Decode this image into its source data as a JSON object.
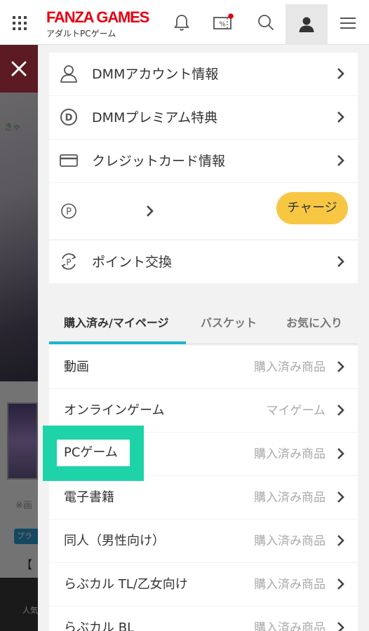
{
  "header": {
    "logo": "FANZA GAMES",
    "logo_sub": "アダルトPCゲーム"
  },
  "background": {
    "banner_text": "きゃ",
    "note": "※画",
    "pill": "プラ",
    "bracket": "【",
    "footer_label": "人気"
  },
  "account_menu": [
    {
      "label": "DMMアカウント情報",
      "icon": "user-icon"
    },
    {
      "label": "DMMプレミアム特典",
      "icon": "premium-d-icon"
    },
    {
      "label": "クレジットカード情報",
      "icon": "credit-card-icon"
    },
    {
      "label": "",
      "icon": "point-icon",
      "action": "チャージ"
    },
    {
      "label": "ポイント交換",
      "icon": "point-exchange-icon"
    }
  ],
  "tabs": [
    {
      "label": "購入済み/マイページ",
      "active": true
    },
    {
      "label": "バスケット",
      "active": false
    },
    {
      "label": "お気に入り",
      "active": false
    }
  ],
  "list": [
    {
      "label": "動画",
      "sub": "購入済み商品"
    },
    {
      "label": "オンラインゲーム",
      "sub": "マイゲーム"
    },
    {
      "label": "PCゲーム",
      "sub": "購入済み商品"
    },
    {
      "label": "電子書籍",
      "sub": "購入済み商品"
    },
    {
      "label": "同人（男性向け）",
      "sub": "購入済み商品"
    },
    {
      "label": "らぶカル TL/乙女向け",
      "sub": "購入済み商品"
    },
    {
      "label": "らぶカル BL",
      "sub": "購入済み商品"
    }
  ],
  "colors": {
    "brand_red": "#e60012",
    "tab_accent": "#1bb4cf",
    "charge_button": "#f7c744",
    "highlight": "#1dd3a7"
  }
}
